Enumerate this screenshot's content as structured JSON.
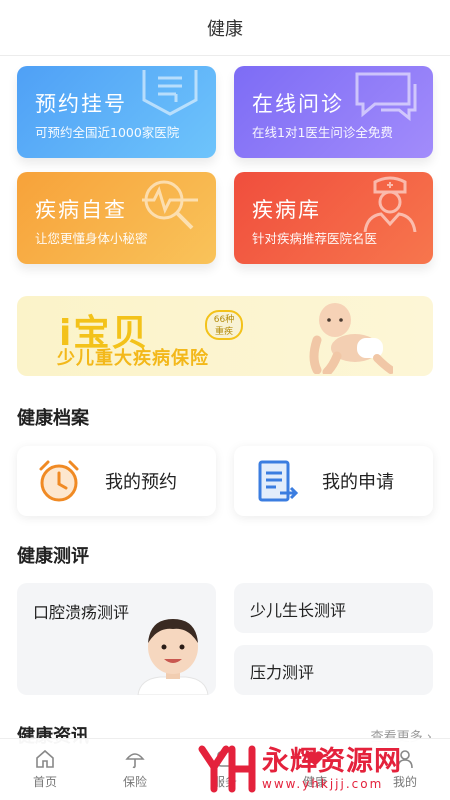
{
  "header": {
    "title": "健康"
  },
  "services": [
    {
      "title": "预约挂号",
      "subtitle": "可预约全国近1000家医院",
      "icon": "registration-number-icon"
    },
    {
      "title": "在线问诊",
      "subtitle": "在线1对1医生问诊全免费",
      "icon": "chat-bubble-icon"
    },
    {
      "title": "疾病自查",
      "subtitle": "让您更懂身体小秘密",
      "icon": "magnifier-pulse-icon"
    },
    {
      "title": "疾病库",
      "subtitle": "针对疾病推荐医院名医",
      "icon": "doctor-icon"
    }
  ],
  "banner": {
    "title": "i宝贝",
    "badge_line1": "66种",
    "badge_line2": "重疾",
    "subtitle": "少儿重大疾病保险"
  },
  "health_records": {
    "title": "健康档案",
    "items": [
      {
        "label": "我的预约",
        "icon": "alarm-clock-icon"
      },
      {
        "label": "我的申请",
        "icon": "document-export-icon"
      }
    ]
  },
  "health_eval": {
    "title": "健康测评",
    "items": [
      {
        "label": "口腔溃疡测评"
      },
      {
        "label": "少儿生长测评"
      },
      {
        "label": "压力测评"
      }
    ]
  },
  "news": {
    "title": "健康资讯",
    "more": "查看更多 ›"
  },
  "tabbar": [
    {
      "label": "首页",
      "icon": "home-icon"
    },
    {
      "label": "保险",
      "icon": "umbrella-icon"
    },
    {
      "label": "服务",
      "icon": "service-icon"
    },
    {
      "label": "健康",
      "icon": "heart-icon"
    },
    {
      "label": "我的",
      "icon": "user-icon"
    }
  ],
  "watermark": {
    "main": "永辉资源网",
    "url": "www.yhkjjj.com"
  },
  "colors": {
    "blue": "#4fa0f6",
    "purple": "#7d6cf5",
    "orange": "#f7a23a",
    "red": "#f04e3d",
    "banner_yellow": "#f3c21a",
    "watermark_red": "#e4223c"
  }
}
